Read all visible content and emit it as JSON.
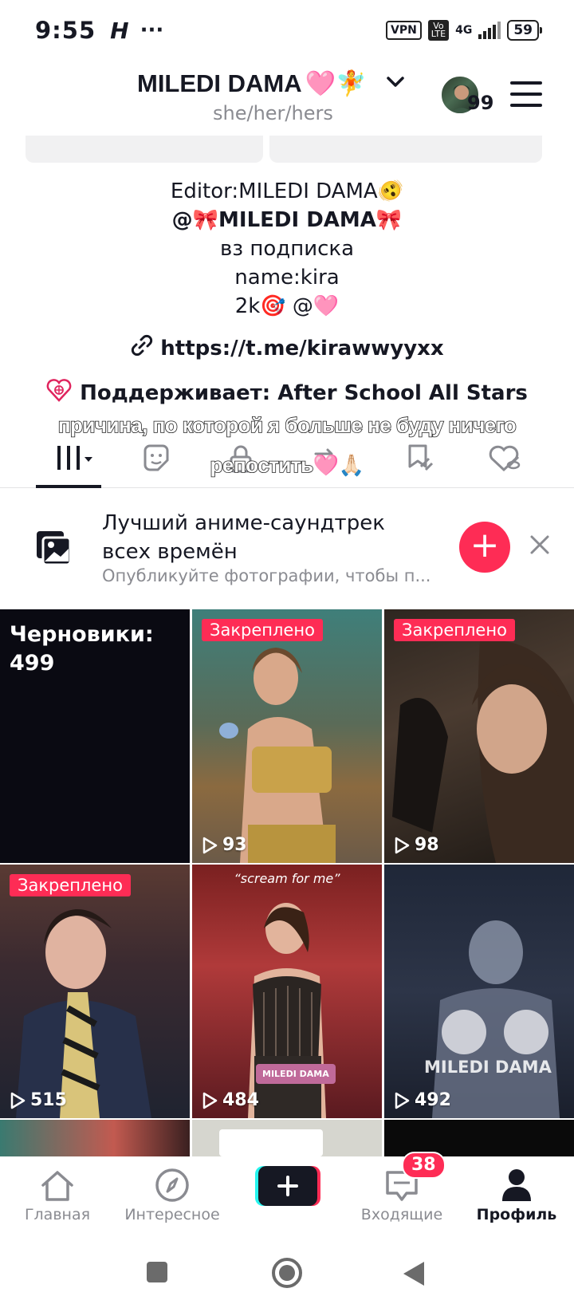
{
  "status_bar": {
    "time": "9:55",
    "app_icon": "H",
    "more": "···",
    "vpn": "VPN",
    "volte": "Vo LTE",
    "network": "4G",
    "battery": "59"
  },
  "header": {
    "username": "MILEDI DAMA",
    "username_emojis": "🩷🧚",
    "pronouns": "she/her/hers",
    "avatar_count": "99"
  },
  "bio": {
    "line1": "Editor:MILEDI DAMA🫨",
    "line2": "@🎀MILEDI DAMA🎀",
    "line3": "вз подписка",
    "line4": "name:kira",
    "line5": "2k🎯 @🩷",
    "link": "https://t.me/kirawwyyxx",
    "support": "Поддерживает: After School All Stars"
  },
  "overlay": {
    "line1": "причина, по которой я больше не буду ничего",
    "line2": "репостить🩷🙏🏻"
  },
  "promo": {
    "title": "Лучший аниме-саундтрек всех времён",
    "subtitle": "Опубликуйте фотографии, чтобы п..."
  },
  "grid": {
    "drafts_label": "Черновики:",
    "drafts_count": "499",
    "pinned_label": "Закреплено",
    "tiles": [
      {
        "views": "93"
      },
      {
        "views": "98"
      },
      {
        "views": "515"
      },
      {
        "views": "484"
      },
      {
        "views": "492"
      }
    ],
    "caption_scream": "“scream for me”",
    "watermark_small": "MILEDI DAMA",
    "watermark_large": "MILEDI DAMA"
  },
  "bottom_nav": {
    "home": "Главная",
    "discover": "Интересное",
    "inbox": "Входящие",
    "inbox_badge": "38",
    "profile": "Профиль"
  },
  "colors": {
    "accent": "#fe2c55",
    "text": "#161823",
    "muted": "#8a8b91"
  }
}
